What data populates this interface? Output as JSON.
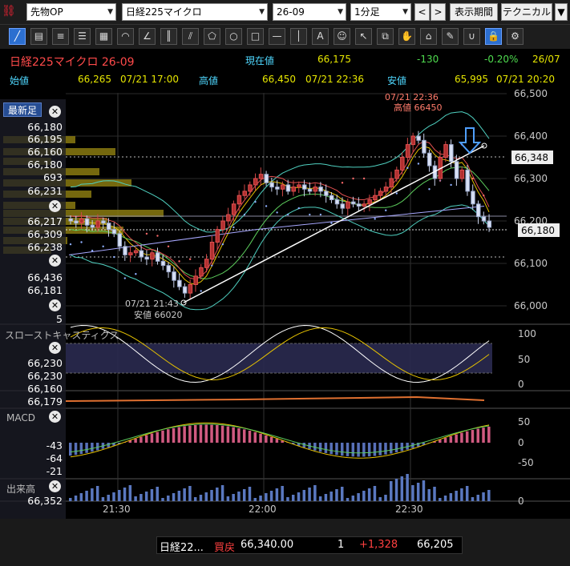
{
  "toolbar_top": {
    "market": "先物OP",
    "symbol": "日経225マイクロ",
    "contract": "26-09",
    "interval": "1分足",
    "prev_label": "<",
    "next_label": ">",
    "period_label": "表示期間",
    "technical_label": "テクニカル"
  },
  "tools": [
    "line",
    "ruler",
    "lines",
    "hlines",
    "grid",
    "arc",
    "fan",
    "vlines",
    "channel",
    "pentagon",
    "circle",
    "rect",
    "hline",
    "vline",
    "text",
    "icon",
    "cursor",
    "copy",
    "hand",
    "tag",
    "tags",
    "magnet",
    "lock",
    "gear"
  ],
  "info": {
    "name": "日経225マイクロ 26-09",
    "current_label": "現在値",
    "current_value": "66,175",
    "change": "-130",
    "change_pct": "-0.20%",
    "date": "26/07",
    "open_label": "始値",
    "open_value": "66,265",
    "open_time": "07/21  17:00",
    "high_label": "高値",
    "high_value": "66,450",
    "high_time": "07/21  22:36",
    "low_label": "安値",
    "low_value": "65,995",
    "low_time": "07/21  20:20"
  },
  "left_panel": {
    "latest_label": "最新足",
    "price_values": [
      "66,180",
      "66,195",
      "66,160",
      "66,180",
      "693",
      "66,231",
      "66,217",
      "66,309",
      "66,238",
      "66,436",
      "66,181",
      "5"
    ],
    "stoch_label": "スローストキャスティクス",
    "stoch_values": [
      "66,230",
      "66,230",
      "66,160",
      "66,179"
    ],
    "macd_label": "MACD",
    "macd_values": [
      "-43",
      "-64",
      "-21"
    ],
    "volume_label": "出来高",
    "volume_value": "66,352"
  },
  "axes": {
    "price_ticks": [
      "66,500",
      "66,400",
      "66,300",
      "66,200",
      "66,100",
      "66,000"
    ],
    "stoch_ticks": [
      "100",
      "50",
      "0"
    ],
    "macd_ticks": [
      "50",
      "0",
      "-50"
    ],
    "volume_ticks": [
      "0"
    ],
    "time_ticks": [
      "21:30",
      "22:00",
      "22:30"
    ],
    "price_tag_1": "66,348",
    "price_tag_2": "66,180"
  },
  "annotations": {
    "high_time": "07/21 22:36",
    "high_text": "高値 66450",
    "low_time": "07/21 21:43",
    "low_text": "安値 66020"
  },
  "status": {
    "name": "日経22...",
    "side": "買戻",
    "price": "66,340.00",
    "qty": "1",
    "pl": "+1,328",
    "last": "66,205"
  },
  "colors": {
    "up": "#c23a3a",
    "down": "#b9c7e6",
    "bollinger": "#4fd0c0",
    "yellow": "#e6c200",
    "green": "#4fc94f",
    "red_text": "#ff4040"
  }
}
